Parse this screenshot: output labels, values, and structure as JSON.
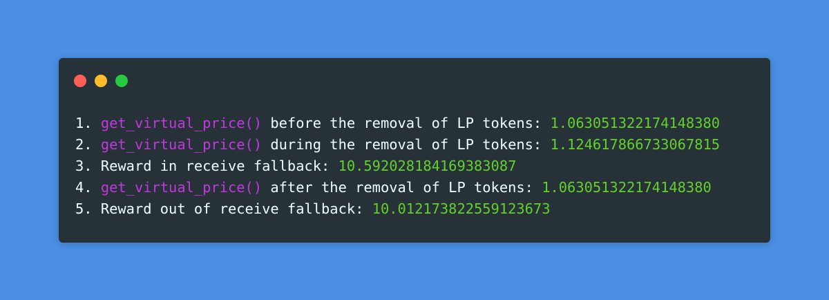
{
  "colors": {
    "background": "#4a8fe2",
    "window": "#263238",
    "text": "#eeffff",
    "function": "#c238e0",
    "number": "#63d12a",
    "dot_close": "#ff5f56",
    "dot_minimize": "#ffbd2e",
    "dot_maximize": "#27c93f"
  },
  "window_controls": [
    "close-dot",
    "minimize-dot",
    "maximize-dot"
  ],
  "lines": [
    {
      "prefix": "1. ",
      "fn": "get_virtual_price()",
      "text": " before the removal of LP tokens: ",
      "value": "1.063051322174148380"
    },
    {
      "prefix": "2. ",
      "fn": "get_virtual_price()",
      "text": " during the removal of LP tokens: ",
      "value": "1.124617866733067815"
    },
    {
      "prefix": "3. ",
      "fn": "",
      "text": "Reward in receive fallback: ",
      "value": "10.592028184169383087"
    },
    {
      "prefix": "4. ",
      "fn": "get_virtual_price()",
      "text": " after the removal of LP tokens: ",
      "value": "1.063051322174148380"
    },
    {
      "prefix": "5. ",
      "fn": "",
      "text": "Reward out of receive fallback: ",
      "value": "10.012173822559123673"
    }
  ]
}
